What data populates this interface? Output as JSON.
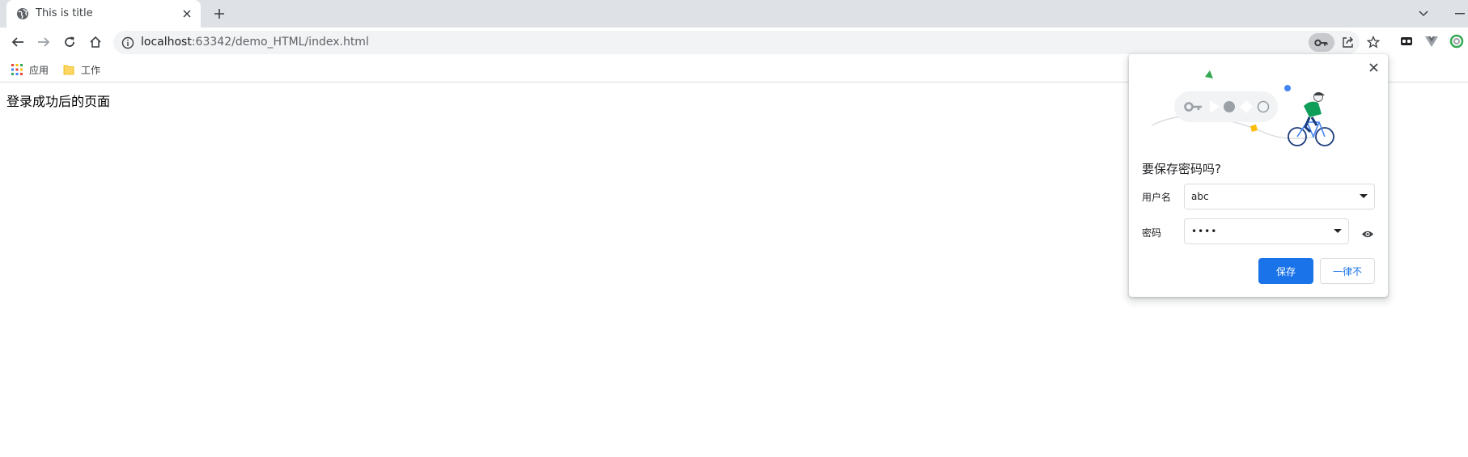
{
  "browser": {
    "tab": {
      "title": "This is title"
    },
    "address_bar": {
      "host": "localhost",
      "path": ":63342/demo_HTML/index.html"
    },
    "bookmarks": [
      {
        "label": "应用",
        "icon": "apps-grid-icon"
      },
      {
        "label": "工作",
        "icon": "folder-icon"
      }
    ]
  },
  "page": {
    "text": "登录成功后的页面"
  },
  "save_password_dialog": {
    "title": "要保存密码吗?",
    "username_label": "用户名",
    "username_value": "abc",
    "password_label": "密码",
    "password_value": "••••",
    "save_button": "保存",
    "never_button": "一律不"
  },
  "colors": {
    "accent": "#1a73e8",
    "tabstrip": "#dee1e6",
    "omnibox": "#f1f3f4"
  }
}
